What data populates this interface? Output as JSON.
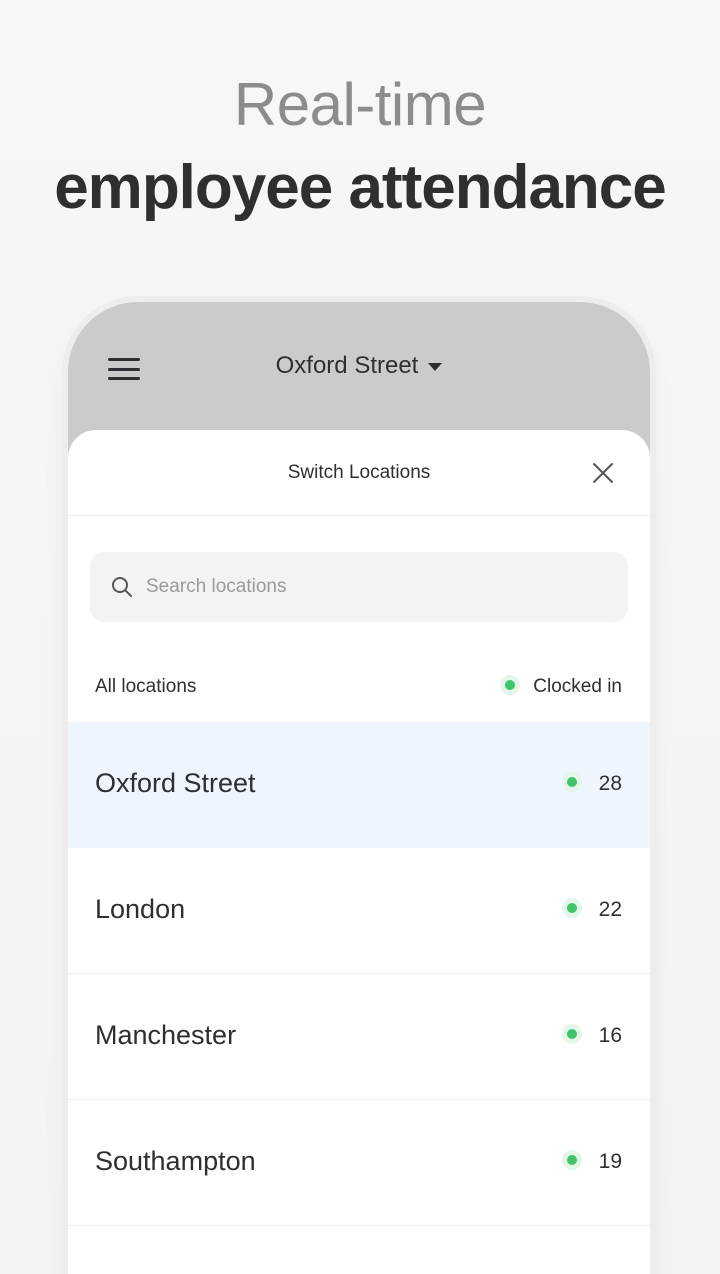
{
  "headline": {
    "light": "Real-time",
    "bold": "employee attendance"
  },
  "app_header": {
    "current_location": "Oxford Street"
  },
  "sheet": {
    "title": "Switch Locations",
    "search_placeholder": "Search locations",
    "list_label": "All locations",
    "status_label": "Clocked in"
  },
  "locations": [
    {
      "name": "Oxford Street",
      "count": "28",
      "selected": true
    },
    {
      "name": "London",
      "count": "22",
      "selected": false
    },
    {
      "name": "Manchester",
      "count": "16",
      "selected": false
    },
    {
      "name": "Southampton",
      "count": "19",
      "selected": false
    }
  ],
  "colors": {
    "status_green": "#3ec46b",
    "selected_row": "#eff5fd",
    "text": "#2e2f33"
  },
  "icons": [
    "menu-icon",
    "caret-down-icon",
    "close-icon",
    "search-icon",
    "status-dot-icon"
  ]
}
